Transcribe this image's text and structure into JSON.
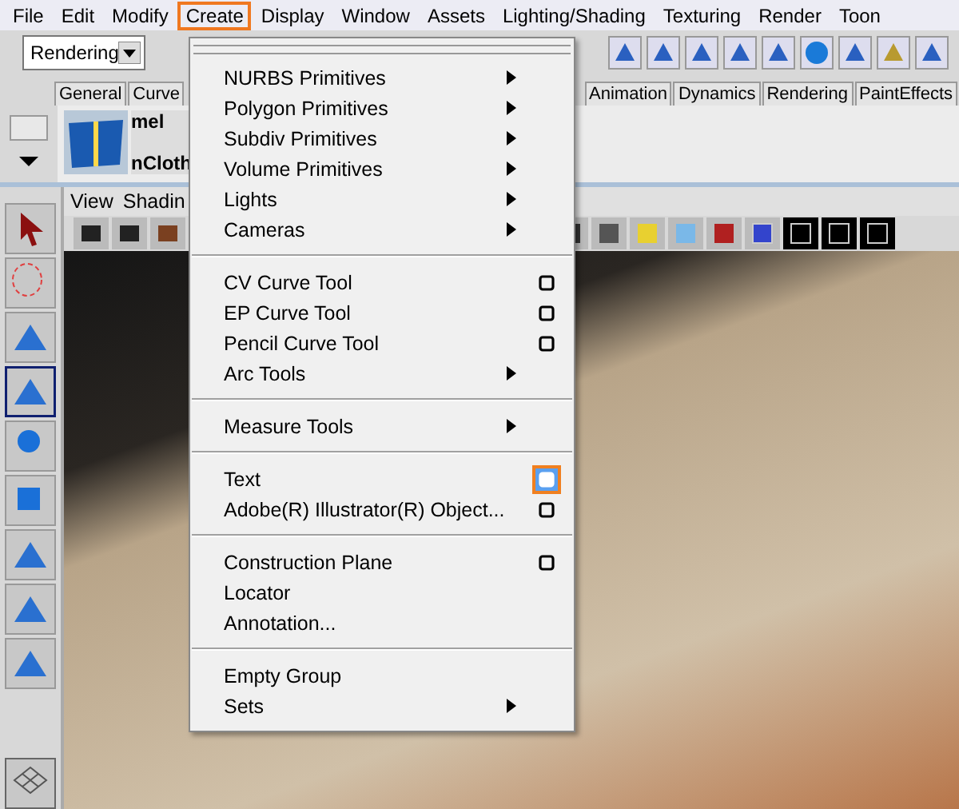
{
  "menu_bar": [
    {
      "label": "File",
      "selected": false
    },
    {
      "label": "Edit",
      "selected": false
    },
    {
      "label": "Modify",
      "selected": false
    },
    {
      "label": "Create",
      "selected": true
    },
    {
      "label": "Display",
      "selected": false
    },
    {
      "label": "Window",
      "selected": false
    },
    {
      "label": "Assets",
      "selected": false
    },
    {
      "label": "Lighting/Shading",
      "selected": false
    },
    {
      "label": "Texturing",
      "selected": false
    },
    {
      "label": "Render",
      "selected": false
    },
    {
      "label": "Toon",
      "selected": false
    }
  ],
  "status_line": {
    "mode_dropdown": "Rendering"
  },
  "shelf_tabs_left": [
    "General",
    "Curve"
  ],
  "shelf_tabs_right": [
    "Animation",
    "Dynamics",
    "Rendering",
    "PaintEffects"
  ],
  "shelf": {
    "mel_label": "mel",
    "ncloth_label": "nCloth"
  },
  "viewport": {
    "menus": [
      "View",
      "Shadin"
    ]
  },
  "create_menu": {
    "sections": [
      [
        {
          "label": "NURBS Primitives",
          "kind": "submenu"
        },
        {
          "label": "Polygon Primitives",
          "kind": "submenu"
        },
        {
          "label": "Subdiv Primitives",
          "kind": "submenu"
        },
        {
          "label": "Volume Primitives",
          "kind": "submenu"
        },
        {
          "label": "Lights",
          "kind": "submenu"
        },
        {
          "label": "Cameras",
          "kind": "submenu"
        }
      ],
      [
        {
          "label": "CV Curve Tool",
          "kind": "option",
          "selected": false
        },
        {
          "label": "EP Curve Tool",
          "kind": "option",
          "selected": false
        },
        {
          "label": "Pencil Curve Tool",
          "kind": "option",
          "selected": false
        },
        {
          "label": "Arc Tools",
          "kind": "submenu"
        }
      ],
      [
        {
          "label": "Measure Tools",
          "kind": "submenu"
        }
      ],
      [
        {
          "label": "Text",
          "kind": "option",
          "selected": true
        },
        {
          "label": "Adobe(R) Illustrator(R) Object...",
          "kind": "option",
          "selected": false
        }
      ],
      [
        {
          "label": "Construction Plane",
          "kind": "option",
          "selected": false
        },
        {
          "label": "Locator",
          "kind": "plain"
        },
        {
          "label": "Annotation...",
          "kind": "plain"
        }
      ],
      [
        {
          "label": "Empty Group",
          "kind": "plain"
        },
        {
          "label": "Sets",
          "kind": "submenu"
        }
      ]
    ]
  }
}
